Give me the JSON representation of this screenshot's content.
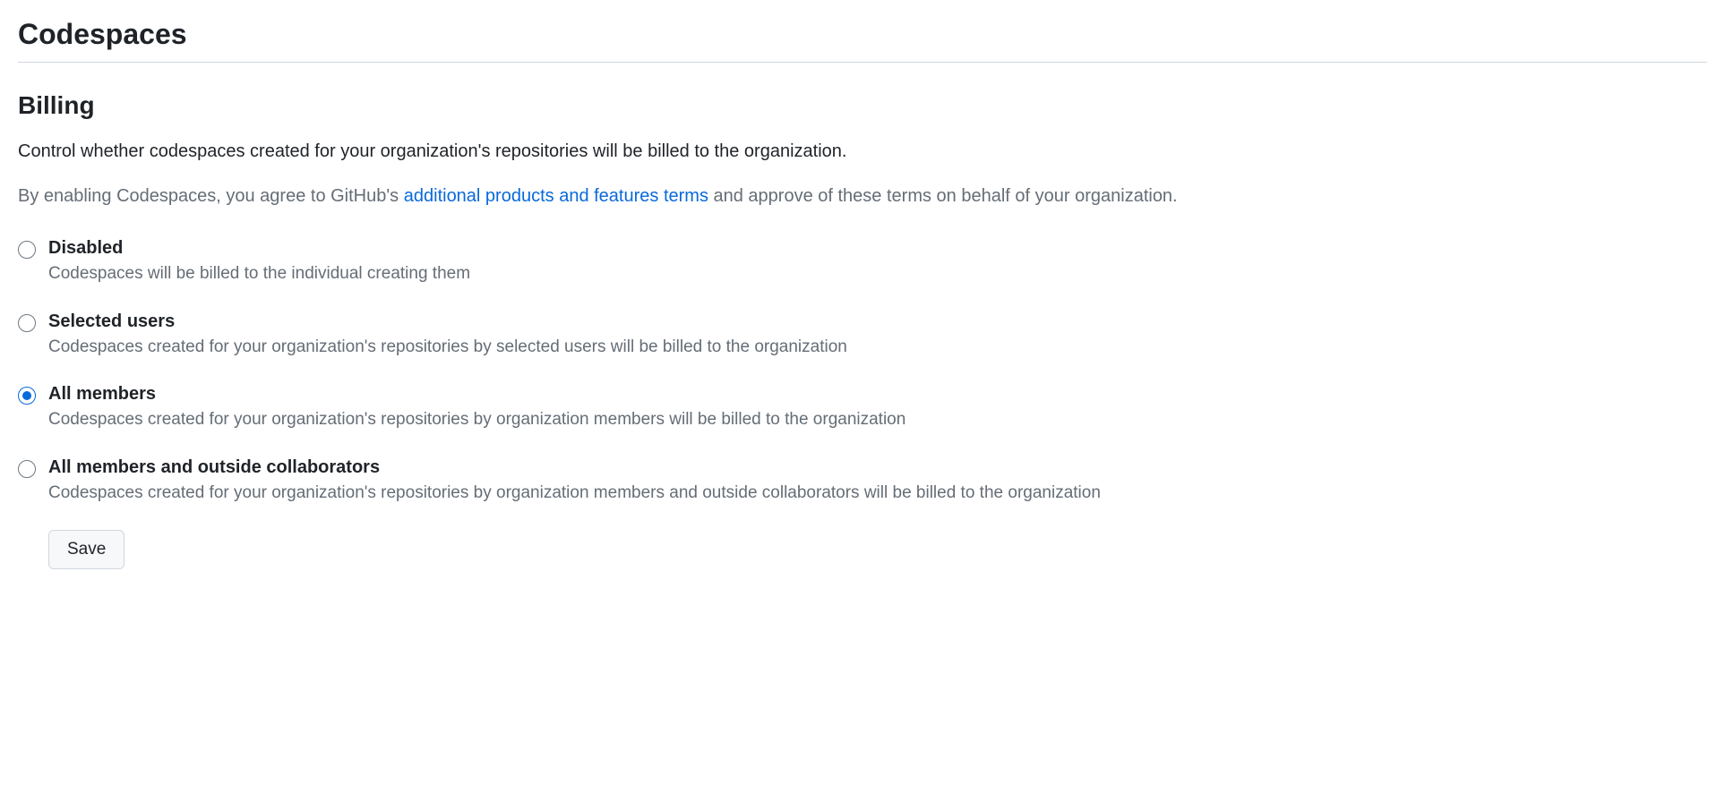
{
  "page": {
    "title": "Codespaces"
  },
  "billing": {
    "section_title": "Billing",
    "description": "Control whether codespaces created for your organization's repositories will be billed to the organization.",
    "terms_prefix": "By enabling Codespaces, you agree to GitHub's ",
    "terms_link_text": "additional products and features terms",
    "terms_suffix": " and approve of these terms on behalf of your organization.",
    "options": [
      {
        "label": "Disabled",
        "description": "Codespaces will be billed to the individual creating them",
        "selected": false
      },
      {
        "label": "Selected users",
        "description": "Codespaces created for your organization's repositories by selected users will be billed to the organization",
        "selected": false
      },
      {
        "label": "All members",
        "description": "Codespaces created for your organization's repositories by organization members will be billed to the organization",
        "selected": true
      },
      {
        "label": "All members and outside collaborators",
        "description": "Codespaces created for your organization's repositories by organization members and outside collaborators will be billed to the organization",
        "selected": false
      }
    ],
    "save_label": "Save"
  }
}
